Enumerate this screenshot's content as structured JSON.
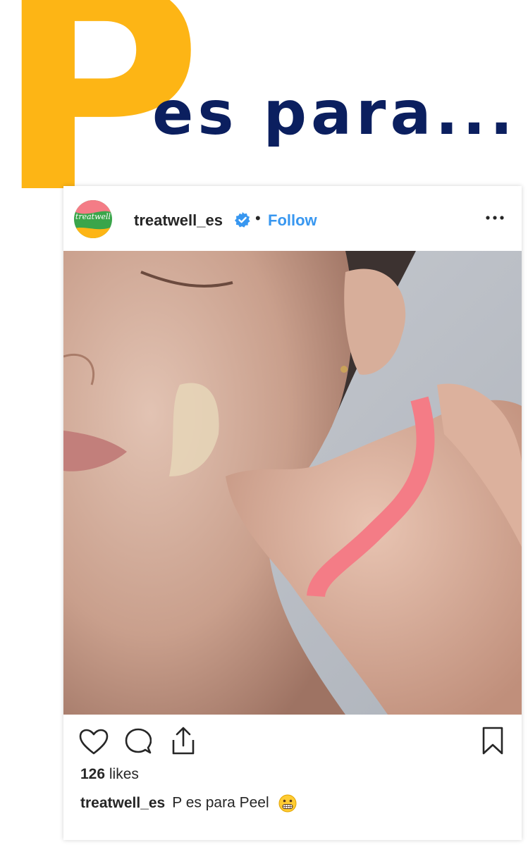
{
  "heading": {
    "letter": "P",
    "rest": "es para...",
    "letter_color": "#fdb515",
    "rest_color": "#0b1f5f"
  },
  "post": {
    "avatar": {
      "icon": "treatwell-logo",
      "text": "treatwell"
    },
    "username": "treatwell_es",
    "verified_icon": "verified-badge-icon",
    "separator": "•",
    "follow_label": "Follow",
    "more_icon": "more-options-icon",
    "photo_icon": "face-peel-photo",
    "actions": {
      "like_icon": "heart-icon",
      "comment_icon": "comment-icon",
      "share_icon": "share-icon",
      "save_icon": "bookmark-icon"
    },
    "likes_count": "126",
    "likes_label": "likes",
    "caption_user": "treatwell_es",
    "caption_text": "P es para Peel",
    "caption_emoji": "grimacing-face-emoji"
  },
  "colors": {
    "follow_blue": "#3897f0",
    "text_dark": "#262626",
    "accent_pink": "#f47c86"
  }
}
